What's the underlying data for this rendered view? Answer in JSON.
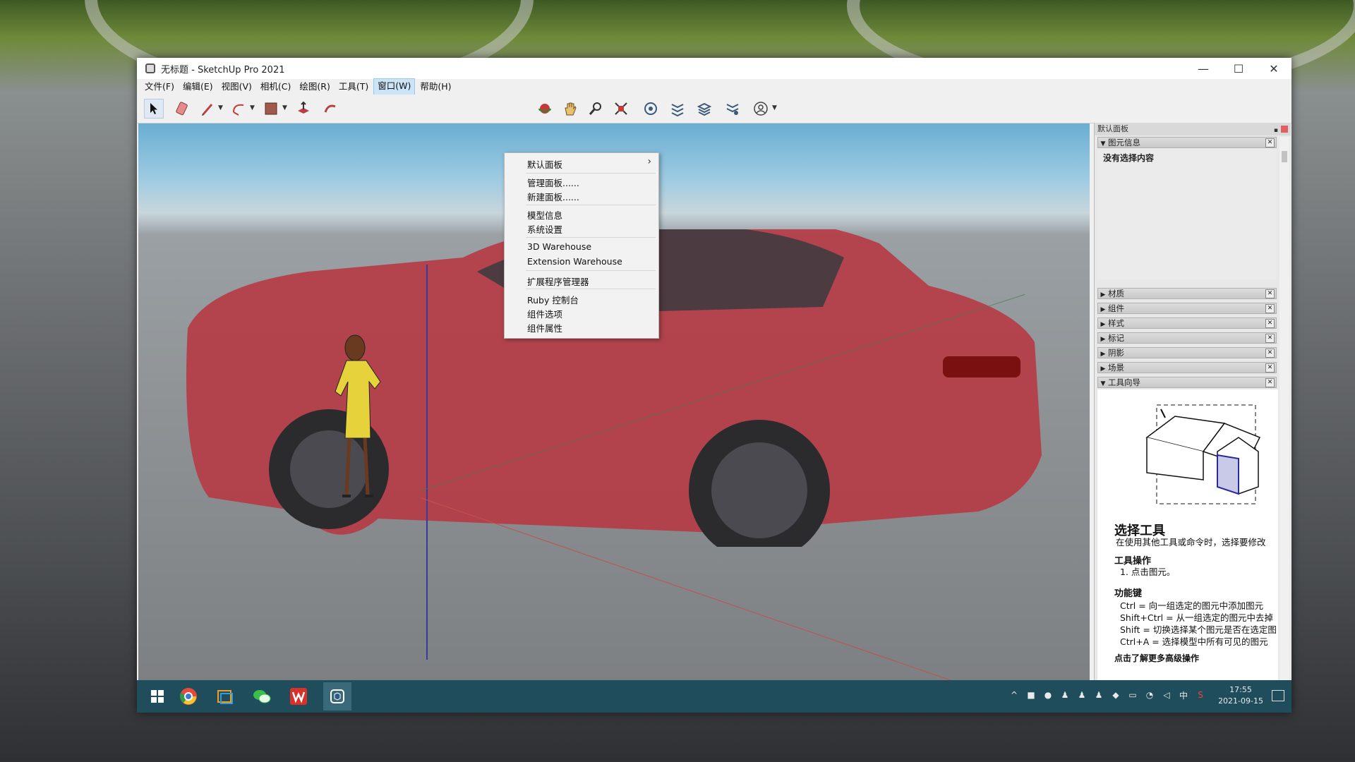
{
  "window": {
    "title": "无标题 - SketchUp Pro 2021",
    "controls": {
      "minimize": "—",
      "maximize": "☐",
      "close": "✕"
    }
  },
  "menubar": [
    "文件(F)",
    "编辑(E)",
    "视图(V)",
    "相机(C)",
    "绘图(R)",
    "工具(T)",
    "窗口(W)",
    "帮助(H)"
  ],
  "active_menu": "窗口(W)",
  "toolbar": {
    "tools": [
      "select-icon",
      "eraser-icon",
      "pencil-icon",
      "arc-icon",
      "rectangle-icon",
      "pushpull-icon",
      "move-icon",
      "orbit-icon",
      "pan-icon",
      "zoom-icon",
      "zoom-extents-icon",
      "warehouse-icon",
      "extension-icon",
      "layers-icon",
      "settings-icon",
      "account-icon"
    ]
  },
  "window_menu": {
    "items": [
      {
        "label": "默认面板",
        "submenu": true
      },
      {
        "label": "管理面板......"
      },
      {
        "label": "新建面板......"
      },
      {
        "label": "模型信息"
      },
      {
        "label": "系统设置"
      },
      {
        "label": "3D Warehouse"
      },
      {
        "label": "Extension Warehouse"
      },
      {
        "label": "扩展程序管理器"
      },
      {
        "label": "Ruby 控制台"
      },
      {
        "label": "组件选项"
      },
      {
        "label": "组件属性"
      }
    ],
    "submenu_arrow": "›"
  },
  "tray": {
    "title": "默认面板",
    "pin": "▪",
    "entity_info": {
      "label": "图元信息",
      "content": "没有选择内容"
    },
    "panels": [
      "材质",
      "组件",
      "样式",
      "标记",
      "阴影",
      "场景"
    ],
    "guide_panel": "工具向导",
    "expanded_arrow": "▼",
    "collapsed_arrow": "▶",
    "close_glyph": "✕"
  },
  "tool_guide": {
    "title": "选择工具",
    "intro": "在使用其他工具或命令时，选择要修改",
    "operations_heading": "工具操作",
    "operations": [
      "1. 点击图元。"
    ],
    "modifiers_heading": "功能键",
    "modifiers": [
      "Ctrl = 向一组选定的图元中添加图元",
      "Shift+Ctrl = 从一组选定的图元中去掉",
      "Shift = 切换选择某个图元是否在选定图",
      "Ctrl+A = 选择模型中所有可见的图元"
    ],
    "footer": "点击了解更多高级操作"
  },
  "taskbar": {
    "apps": [
      "windows-start-icon",
      "chrome-icon",
      "files-icon",
      "wechat-icon",
      "wps-icon",
      "sketchup-icon"
    ],
    "time": "17:55",
    "date": "2021-09-15",
    "ime": "中"
  },
  "colors": {
    "car": "#c0303a",
    "taskbar": "#1f4d5c",
    "menu_highlight": "#cce4f7"
  }
}
